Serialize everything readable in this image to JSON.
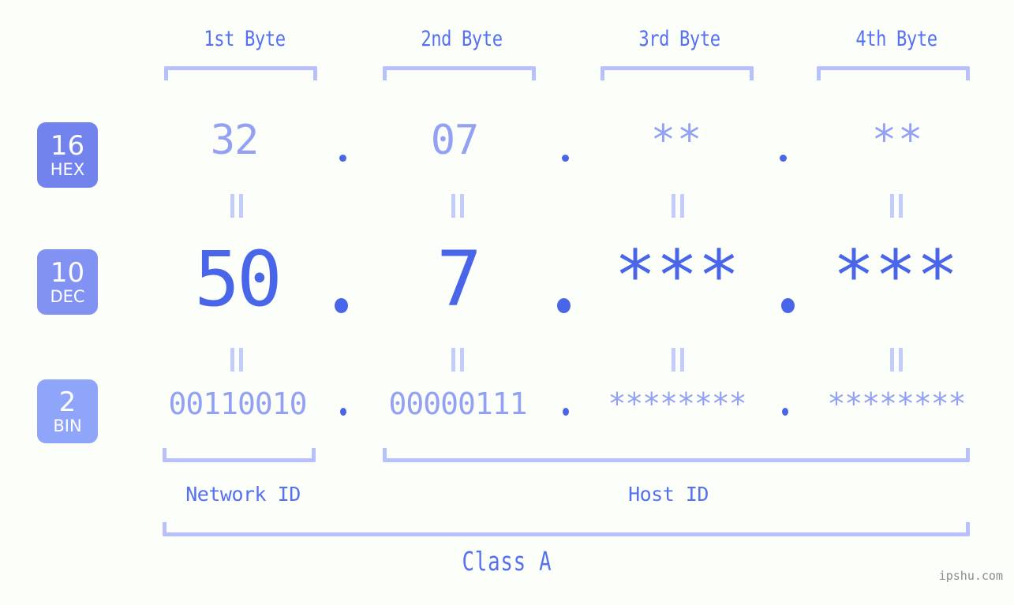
{
  "background_color": "#fcfefa",
  "accent_colors": {
    "strong_blue": "#4a66e8",
    "label_blue": "#5570f0",
    "muted_blue": "#93a1f3",
    "bracket_blue": "#b7c0fb",
    "equals_blue": "#c4ccfc",
    "badge_hex": "#7383ee",
    "badge_dec": "#8292f2",
    "badge_bin": "#8fa5fa",
    "watermark_gray": "#8c8c8c"
  },
  "byte_headers": [
    {
      "label": "1st Byte"
    },
    {
      "label": "2nd Byte"
    },
    {
      "label": "3rd Byte"
    },
    {
      "label": "4th Byte"
    }
  ],
  "radix_badges": [
    {
      "number": "16",
      "name": "HEX"
    },
    {
      "number": "10",
      "name": "DEC"
    },
    {
      "number": "2",
      "name": "BIN"
    }
  ],
  "rows": {
    "hex": {
      "radix": "16",
      "radix_name": "HEX",
      "values": [
        "32",
        "07",
        "**",
        "**"
      ]
    },
    "dec": {
      "radix": "10",
      "radix_name": "DEC",
      "values": [
        "50",
        "7",
        "***",
        "***"
      ]
    },
    "bin": {
      "radix": "2",
      "radix_name": "BIN",
      "values": [
        "00110010",
        "00000111",
        "********",
        "********"
      ]
    }
  },
  "separator": ".",
  "equals_mark": "=",
  "id_labels": {
    "network": "Network ID",
    "host": "Host ID"
  },
  "class_label": "Class A",
  "watermark": "ipshu.com"
}
